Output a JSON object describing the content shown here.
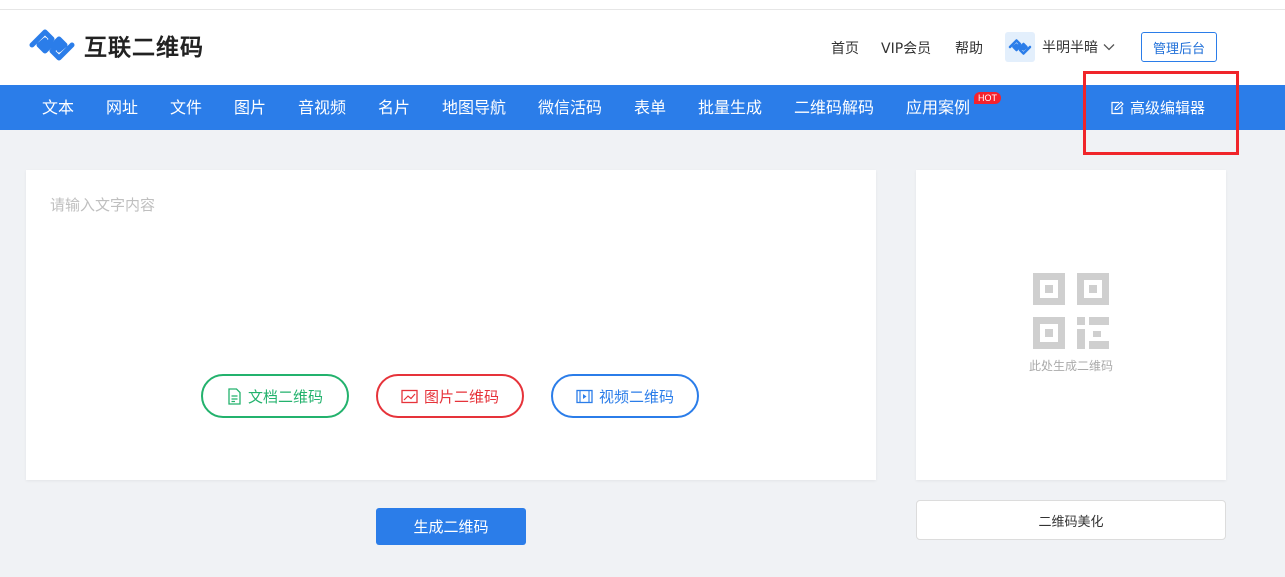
{
  "brand": {
    "name": "互联二维码",
    "color": "#2b7de9"
  },
  "top_links": {
    "home": "首页",
    "vip": "VIP会员",
    "help": "帮助"
  },
  "user": {
    "name": "半明半暗"
  },
  "admin_button": "管理后台",
  "nav": {
    "items": [
      "文本",
      "网址",
      "文件",
      "图片",
      "音视频",
      "名片",
      "地图导航",
      "微信活码",
      "表单",
      "批量生成",
      "二维码解码",
      "应用案例"
    ],
    "hot_badge": "HOT",
    "advanced_editor": "高级编辑器"
  },
  "editor": {
    "placeholder": "请输入文字内容",
    "buttons": {
      "doc": "文档二维码",
      "image": "图片二维码",
      "video": "视频二维码"
    },
    "generate": "生成二维码"
  },
  "qr_panel": {
    "hint": "此处生成二维码",
    "beautify": "二维码美化"
  },
  "colors": {
    "accent": "#2b7de9",
    "green": "#23b26d",
    "red": "#e6333a",
    "highlight": "#f0252a"
  }
}
